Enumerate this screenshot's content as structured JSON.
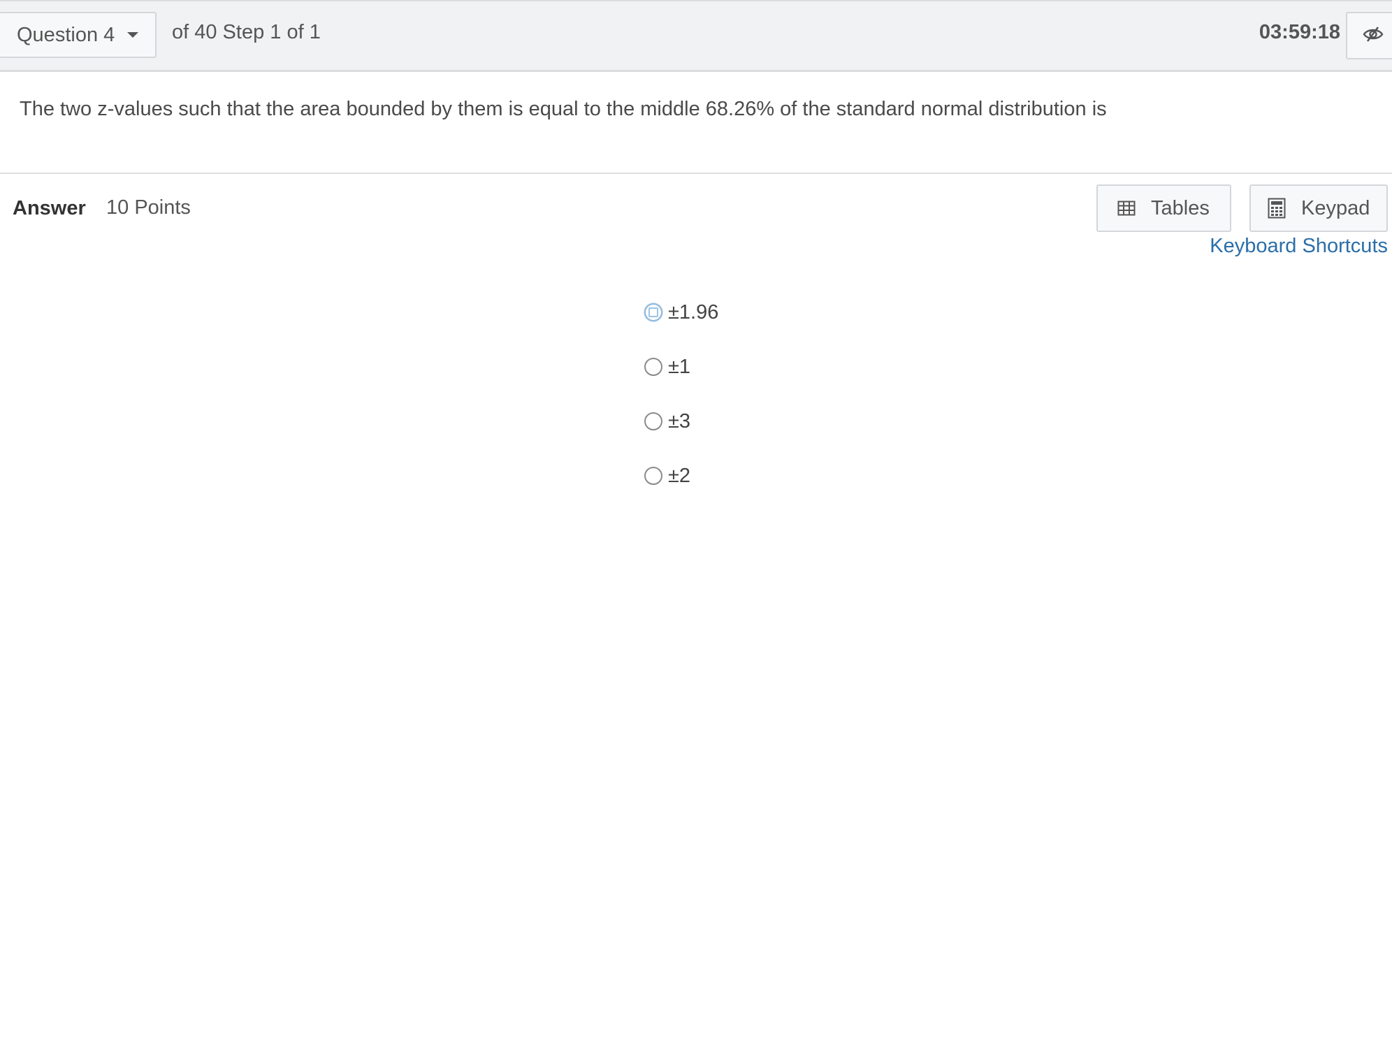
{
  "header": {
    "question_select": "Question 4",
    "progress": "of 40 Step 1 of 1",
    "timer": "03:59:18",
    "visibility_icon": "eye-slash-icon"
  },
  "question": {
    "text": "The two z-values such that the area bounded by them is equal to the middle 68.26% of the standard normal distribution is"
  },
  "answer": {
    "label": "Answer",
    "points": "10 Points",
    "tables_label": "Tables",
    "keypad_label": "Keypad",
    "keyboard_shortcuts": "Keyboard Shortcuts",
    "options": [
      {
        "label": "±1.96",
        "focused": true
      },
      {
        "label": "±1",
        "focused": false
      },
      {
        "label": "±3",
        "focused": false
      },
      {
        "label": "±2",
        "focused": false
      }
    ]
  },
  "colors": {
    "link": "#2b6ea8",
    "topbar_bg": "#f1f2f3",
    "focus_ring": "#8fb9dd"
  }
}
